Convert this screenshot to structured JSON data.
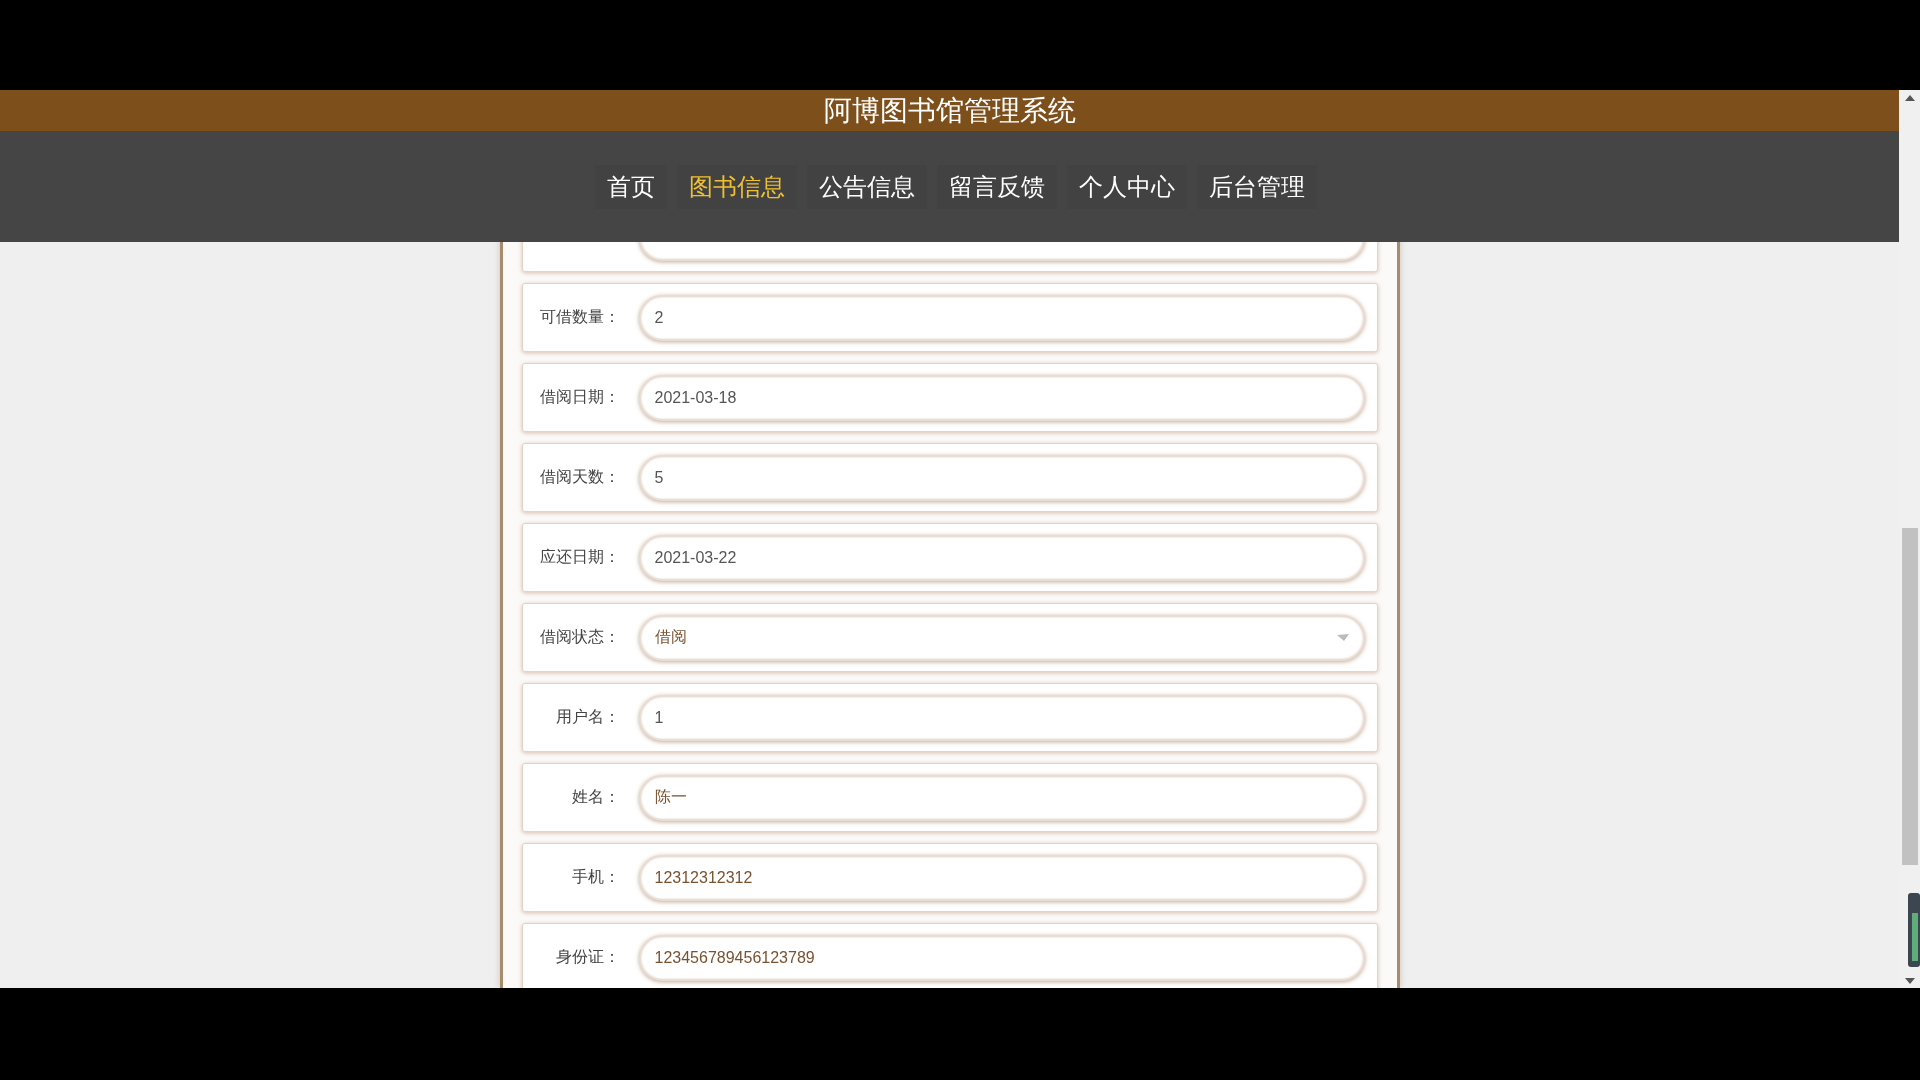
{
  "header": {
    "title": "阿博图书馆管理系统"
  },
  "nav": [
    {
      "label": "首页",
      "selected": false
    },
    {
      "label": "图书信息",
      "selected": true
    },
    {
      "label": "公告信息",
      "selected": false
    },
    {
      "label": "留言反馈",
      "selected": false
    },
    {
      "label": "个人中心",
      "selected": false
    },
    {
      "label": "后台管理",
      "selected": false
    }
  ],
  "form": {
    "fields": [
      {
        "kind": "text",
        "label": "可借数量：",
        "value": "2",
        "readonly": true
      },
      {
        "kind": "text",
        "label": "借阅日期：",
        "value": "2021-03-18",
        "readonly": true
      },
      {
        "kind": "text",
        "label": "借阅天数：",
        "value": "5",
        "readonly": true
      },
      {
        "kind": "text",
        "label": "应还日期：",
        "value": "2021-03-22",
        "readonly": true
      },
      {
        "kind": "select",
        "label": "借阅状态：",
        "value": "借阅",
        "readonly": false
      },
      {
        "kind": "text",
        "label": "用户名：",
        "value": "1",
        "readonly": true
      },
      {
        "kind": "text",
        "label": "姓名：",
        "value": "陈一",
        "readonly": false
      },
      {
        "kind": "text",
        "label": "手机：",
        "value": "12312312312",
        "readonly": false
      },
      {
        "kind": "text",
        "label": "身份证：",
        "value": "123456789456123789",
        "readonly": false
      }
    ]
  }
}
